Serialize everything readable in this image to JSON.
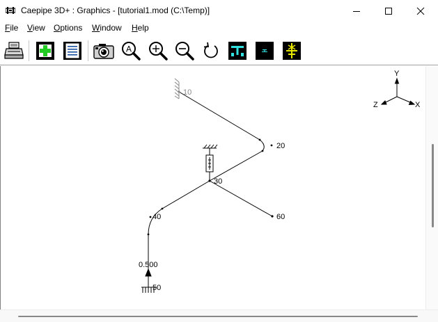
{
  "window": {
    "title": "Caepipe 3D+ : Graphics -  [tutorial1.mod (C:\\Temp)]"
  },
  "menu": [
    {
      "label": "File",
      "mnemonic": "F",
      "rest": "ile"
    },
    {
      "label": "View",
      "mnemonic": "V",
      "rest": "iew"
    },
    {
      "label": "Options",
      "mnemonic": "O",
      "rest": "ptions"
    },
    {
      "label": "Window",
      "mnemonic": "W",
      "rest": "indow"
    },
    {
      "label": "Help",
      "mnemonic": "H",
      "rest": "elp"
    }
  ],
  "toolbar": {
    "icons": [
      "print-icon",
      "add-icon",
      "list-icon",
      "camera-icon",
      "zoom-auto-icon",
      "zoom-in-icon",
      "zoom-out-icon",
      "rotate-icon",
      "pipe-view-icon",
      "small-view-icon",
      "axial-view-icon"
    ],
    "zoom_auto_letter": "A"
  },
  "axes": {
    "y": "Y",
    "x": "X",
    "z": "Z"
  },
  "nodes": {
    "n10": "10",
    "n20": "20",
    "n30": "30",
    "n40": "40",
    "n50": "50",
    "n60": "60"
  },
  "annotations": {
    "elevation": "0.500"
  },
  "colors": {
    "toolbar_icon_bg": "#000000",
    "toolbar_green": "#22cc22",
    "toolbar_cyan": "#33e0e0",
    "toolbar_yellow": "#e8e800",
    "pipe_line": "#000000",
    "node10_gray": "#888888"
  }
}
